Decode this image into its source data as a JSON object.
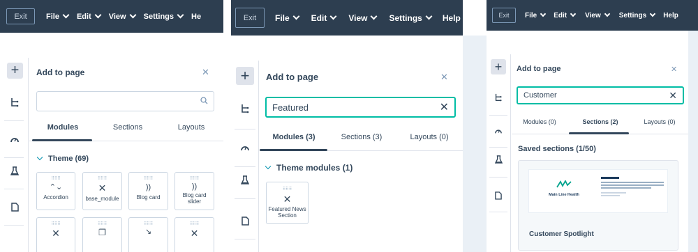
{
  "topbar": {
    "exit_label": "Exit",
    "menu": [
      "File",
      "Edit",
      "View",
      "Settings",
      "Help"
    ],
    "menu_p1_last": "He",
    "bg_color": "#2d3e50"
  },
  "sidebar": {
    "icons": [
      "plus-icon",
      "tree-structure-icon",
      "gauge-icon",
      "flask-icon",
      "page-icon"
    ],
    "plus_glyph": "+"
  },
  "panel1": {
    "title": "Add to page",
    "search_value": "",
    "tabs": [
      "Modules",
      "Sections",
      "Layouts"
    ],
    "active_tab": "Modules",
    "section_header": "Theme (69)",
    "modules": [
      {
        "label": "Accordion",
        "icon": "chevron-updown-icon"
      },
      {
        "label": "base_module",
        "icon": "cross-tools-icon"
      },
      {
        "label": "Blog card",
        "icon": "rss-icon"
      },
      {
        "label": "Blog card slider",
        "icon": "rss-icon"
      }
    ]
  },
  "panel2": {
    "title": "Add to page",
    "search_value": "Featured",
    "tabs": [
      "Modules (3)",
      "Sections (3)",
      "Layouts (0)"
    ],
    "active_tab": "Modules (3)",
    "section_header": "Theme modules (1)",
    "modules": [
      {
        "label": "Featured News Section",
        "icon": "cross-tools-icon"
      }
    ]
  },
  "panel3": {
    "title": "Add to page",
    "search_value": "Customer",
    "tabs": [
      "Modules (0)",
      "Sections (2)",
      "Layouts (0)"
    ],
    "active_tab": "Sections (2)",
    "section_header": "Saved sections (1/50)",
    "saved_section": {
      "label": "Customer Spotlight",
      "logo_text": "Main Line Health"
    }
  },
  "colors": {
    "accent_teal": "#00bda5",
    "text_dark": "#33475b",
    "border": "#cbd6e2"
  }
}
